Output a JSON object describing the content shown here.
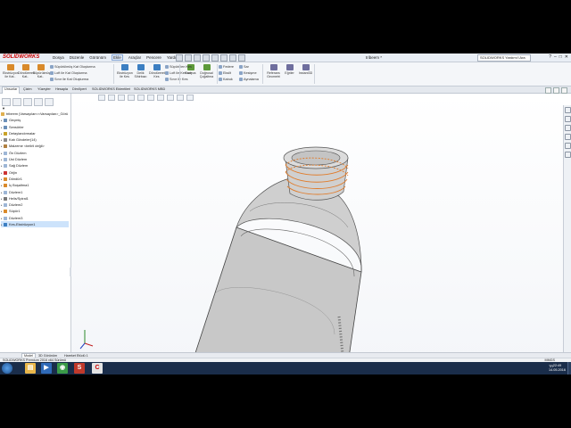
{
  "app": {
    "logo_brand": "SOLIDWORKS",
    "document_title": "tribeem *",
    "search_placeholder": "SOLIDWORKS Yardımı'i Ara",
    "accent": "#c00000"
  },
  "menus": [
    "Dosya",
    "Düzenle",
    "Görünüm",
    "Ekle",
    "Araçlar",
    "Pencere",
    "Yardım"
  ],
  "active_menu": "Ekle",
  "ribbon": {
    "big_buttons": [
      {
        "label": "Ekstrüzyon ile Kat..",
        "icon": "extrude-boss-icon",
        "color": "#d98a2b"
      },
      {
        "label": "Döndürerek Kat..",
        "icon": "revolve-boss-icon",
        "color": "#d98a2b"
      },
      {
        "label": "Süpürülmüş Kat..",
        "icon": "swept-boss-icon",
        "color": "#d98a2b"
      },
      {
        "label": "Ekstrüzyon ile Kes",
        "icon": "extruded-cut-icon",
        "color": "#3c7fc2"
      },
      {
        "label": "Delik Sihirbazı",
        "icon": "hole-wizard-icon",
        "color": "#3c7fc2"
      },
      {
        "label": "Döndürerek Kes",
        "icon": "revolved-cut-icon",
        "color": "#3c7fc2"
      },
      {
        "label": "Radyus",
        "icon": "fillet-icon",
        "color": "#5d9a3a"
      },
      {
        "label": "Doğrusal Çoğaltma",
        "icon": "linear-pattern-icon",
        "color": "#5d9a3a"
      },
      {
        "label": "Referans Geometri",
        "icon": "reference-geometry-icon",
        "color": "#6e6e9e"
      },
      {
        "label": "Eğriler",
        "icon": "curves-icon",
        "color": "#6e6e9e"
      },
      {
        "label": "Instant3D",
        "icon": "instant3d-icon",
        "color": "#6e6e9e"
      }
    ],
    "small_buttons_1": [
      {
        "label": "Süpürülmüş Kat Oluşturma",
        "icon": "swept-icon"
      },
      {
        "label": "Loft ile Kat Oluşturma",
        "icon": "loft-icon"
      },
      {
        "label": "Sınır ile Kat Oluşturma",
        "icon": "boundary-icon"
      }
    ],
    "small_buttons_2": [
      {
        "label": "Süpürülen Kes",
        "icon": "swept-cut-icon"
      },
      {
        "label": "Loft ile Kes-sm",
        "icon": "lofted-cut-icon"
      },
      {
        "label": "Sınır ile Kes",
        "icon": "boundary-cut-icon"
      }
    ],
    "small_buttons_3": [
      {
        "label": "Federe",
        "icon": "rib-icon"
      },
      {
        "label": "Eksilt",
        "icon": "draft-icon"
      },
      {
        "label": "Kabuk",
        "icon": "shell-icon"
      }
    ],
    "small_buttons_4": [
      {
        "label": "Sar",
        "icon": "wrap-icon"
      },
      {
        "label": "Kesişme",
        "icon": "intersect-icon"
      },
      {
        "label": "Aynalama",
        "icon": "mirror-icon"
      }
    ]
  },
  "command_tabs": [
    "Unsurlar",
    "Çizim",
    "Yüzeyler",
    "Hesapla",
    "DimXpert",
    "SOLIDWORKS Eklentileri",
    "SOLIDWORKS MBD"
  ],
  "active_command_tab": "Unsurlar",
  "tree": {
    "root": "tribeem (Varsayılan<<Varsayılan>_Görü",
    "items": [
      {
        "label": "Geçmiş",
        "icon": "history-icon",
        "color": "#6b8fb8"
      },
      {
        "label": "Sensörler",
        "icon": "sensors-icon",
        "color": "#6b8fb8"
      },
      {
        "label": "Detaylandırmalar",
        "icon": "annotations-icon",
        "color": "#c9a227"
      },
      {
        "label": "Katı Gövdeler(14)",
        "icon": "solid-bodies-icon",
        "color": "#8a8a8a"
      },
      {
        "label": "Malzeme <belirli değil>",
        "icon": "material-icon",
        "color": "#b08040"
      },
      {
        "label": "Ön Düzlem",
        "icon": "plane-icon",
        "color": "#9db6d6"
      },
      {
        "label": "Üst Düzlem",
        "icon": "plane-icon",
        "color": "#9db6d6"
      },
      {
        "label": "Sağ Düzlem",
        "icon": "plane-icon",
        "color": "#9db6d6"
      },
      {
        "label": "Orijin",
        "icon": "origin-icon",
        "color": "#cc3333"
      },
      {
        "label": "Döndür1",
        "icon": "revolve-feature-icon",
        "color": "#d98a2b"
      },
      {
        "label": "İç Boşaltma1",
        "icon": "shell-feature-icon",
        "color": "#d98a2b"
      },
      {
        "label": "Düzlem1",
        "icon": "plane-icon",
        "color": "#9db6d6"
      },
      {
        "label": "Helis/Spiral1",
        "icon": "helix-icon",
        "color": "#7a7a7a"
      },
      {
        "label": "Düzlem2",
        "icon": "plane-icon",
        "color": "#9db6d6"
      },
      {
        "label": "Süpür1",
        "icon": "sweep-feature-icon",
        "color": "#d98a2b"
      },
      {
        "label": "Düzlem3",
        "icon": "plane-icon",
        "color": "#9db6d6"
      },
      {
        "label": "Kes-Ekstrüzyon1",
        "icon": "cut-extrude-icon",
        "color": "#3c7fc2"
      }
    ]
  },
  "bottom_tabs": [
    "Model",
    "3D Görünüm",
    "Hareket Etüdü 1"
  ],
  "active_bottom_tab": "Model",
  "status": {
    "left": "SOLIDWORKS Premium 2016 x64 Sürümü",
    "right": "MMGS"
  },
  "taskbar": {
    "apps": [
      {
        "name": "explorer-app",
        "glyph": "▤",
        "color": "#e8b64a"
      },
      {
        "name": "media-player-app",
        "glyph": "▶",
        "color": "#2f6ab8"
      },
      {
        "name": "chrome-app",
        "glyph": "◉",
        "color": "#3a9a48"
      },
      {
        "name": "solidworks-app",
        "glyph": "S",
        "color": "#c0392b"
      },
      {
        "name": "camtasia-app",
        "glyph": "C",
        "color": "#e4e4e4"
      }
    ],
    "tray_lang": "TR",
    "clock_time": "22:49",
    "clock_date": "14.05.2016"
  }
}
